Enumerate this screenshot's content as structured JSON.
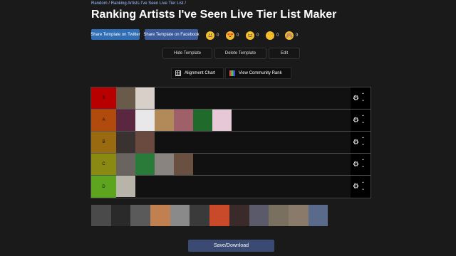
{
  "breadcrumb": {
    "part1": "Random",
    "sep": " / ",
    "part2": "Ranking Artists I've Seen Live Tier List",
    "sep2": " /"
  },
  "page_title": "Ranking Artists I've Seen Live Tier List Maker",
  "share": {
    "twitter": "Share Template on Twitter",
    "facebook": "Share Template on Facebook"
  },
  "reactions": [
    {
      "icon": "smile-emoji-icon",
      "glyph": "😃",
      "count": "0"
    },
    {
      "icon": "heart-eyes-emoji-icon",
      "glyph": "😍",
      "count": "0"
    },
    {
      "icon": "laugh-emoji-icon",
      "glyph": "😆",
      "count": "0"
    },
    {
      "icon": "raised-hands-emoji-icon",
      "glyph": "🙌",
      "count": "0"
    },
    {
      "icon": "see-no-evil-emoji-icon",
      "glyph": "🙈",
      "count": "0"
    }
  ],
  "controls": {
    "hide": "Hide Template",
    "delete": "Delete Template",
    "edit": "Edit",
    "alignment": "Alignment Chart",
    "community": "View Community Rank"
  },
  "tiers": [
    {
      "label": "S",
      "color": "#b80000",
      "count": 2,
      "palette": [
        "#6a5a4a",
        "#d8d0c8"
      ]
    },
    {
      "label": "A",
      "color": "#b04a0d",
      "count": 6,
      "palette": [
        "#5a2640",
        "#e8e8ea",
        "#b28a5a",
        "#a0606a",
        "#206a2c",
        "#e6c8d6"
      ]
    },
    {
      "label": "B",
      "color": "#9a6a10",
      "count": 2,
      "palette": [
        "#3a3230",
        "#6a4a3e"
      ]
    },
    {
      "label": "C",
      "color": "#8a8a12",
      "count": 4,
      "palette": [
        "#6a6460",
        "#2a7a3a",
        "#8a8480",
        "#6a5040"
      ]
    },
    {
      "label": "D",
      "color": "#5ea51f",
      "count": 1,
      "palette": [
        "#b8b4aa"
      ]
    }
  ],
  "pool": {
    "count": 12,
    "palette": [
      "#4a4a4a",
      "#2a2a2a",
      "#5a5a5a",
      "#c08050",
      "#8a8a8a",
      "#3a3a3a",
      "#c84a2a",
      "#3a2a2a",
      "#5a5a6a",
      "#7a7060",
      "#8a7a6a",
      "#5a6a8a"
    ]
  },
  "save_label": "Save/Download"
}
